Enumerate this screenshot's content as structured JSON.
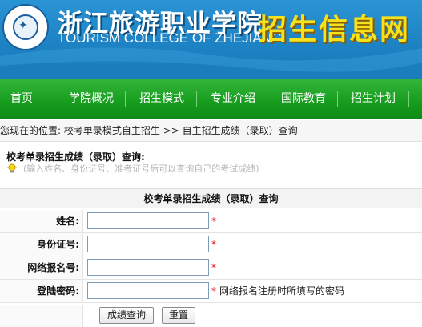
{
  "header": {
    "title_cn": "浙江旅游职业学院",
    "title_en": "TOURISM COLLEGE OF ZHEJIANG",
    "slogan": "招生信息网",
    "logo_icon": "college-seal-icon"
  },
  "nav": {
    "items": [
      {
        "label": "首页"
      },
      {
        "label": "学院概况"
      },
      {
        "label": "招生模式"
      },
      {
        "label": "专业介绍"
      },
      {
        "label": "国际教育"
      },
      {
        "label": "招生计划"
      }
    ]
  },
  "breadcrumb": {
    "prefix": "您现在的位置:",
    "level1": "校考单录模式自主招生",
    "separator": ">>",
    "level2": "自主招生成绩（录取）查询"
  },
  "notice": {
    "title": "校考单录招生成绩（录取）查询:",
    "hint": "(输入姓名、身份证号、准考证号后可以查询自己的考试成绩)"
  },
  "form": {
    "heading": "校考单录招生成绩（录取）查询",
    "fields": [
      {
        "label": "姓名:",
        "value": "",
        "required": "*"
      },
      {
        "label": "身份证号:",
        "value": "",
        "required": "*"
      },
      {
        "label": "网络报名号:",
        "value": "",
        "required": "*"
      },
      {
        "label": "登陆密码:",
        "value": "",
        "required": "*",
        "note": "网络报名注册时所填写的密码"
      }
    ],
    "submit_label": "成绩查询",
    "reset_label": "重置"
  },
  "colors": {
    "banner": "#1d83c4",
    "nav": "#169c1d",
    "slogan": "#f6e21c",
    "required": "#e0101a"
  }
}
